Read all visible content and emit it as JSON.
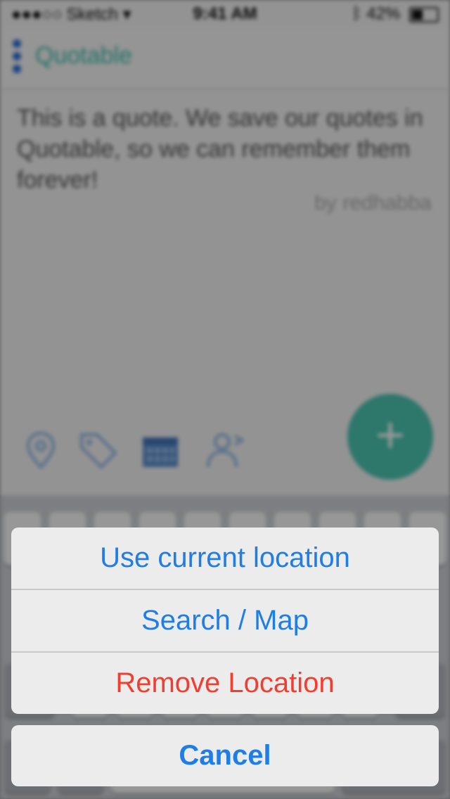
{
  "status_bar": {
    "signal": "●●●○○",
    "carrier": "Sketch",
    "time": "9:41 AM",
    "battery": "42%"
  },
  "nav": {
    "title": "Quotable"
  },
  "quote": {
    "text": "This is a quote. We save our quotes in Quotable, so we can remember them forever!",
    "author": "by redhabba"
  },
  "toolbar": {
    "icons": [
      "location-pin-icon",
      "tag-icon",
      "calendar-icon",
      "person-icon"
    ]
  },
  "fab": {
    "label": "+"
  },
  "action_sheet": {
    "actions": [
      {
        "label": "Use current location"
      },
      {
        "label": "Search / Map"
      },
      {
        "label": "Remove Location"
      }
    ],
    "cancel_label": "Cancel"
  },
  "colors": {
    "accent_blue": "#1f7de6",
    "destructive_red": "#f33d2f",
    "teal": "#4cc6b3"
  }
}
